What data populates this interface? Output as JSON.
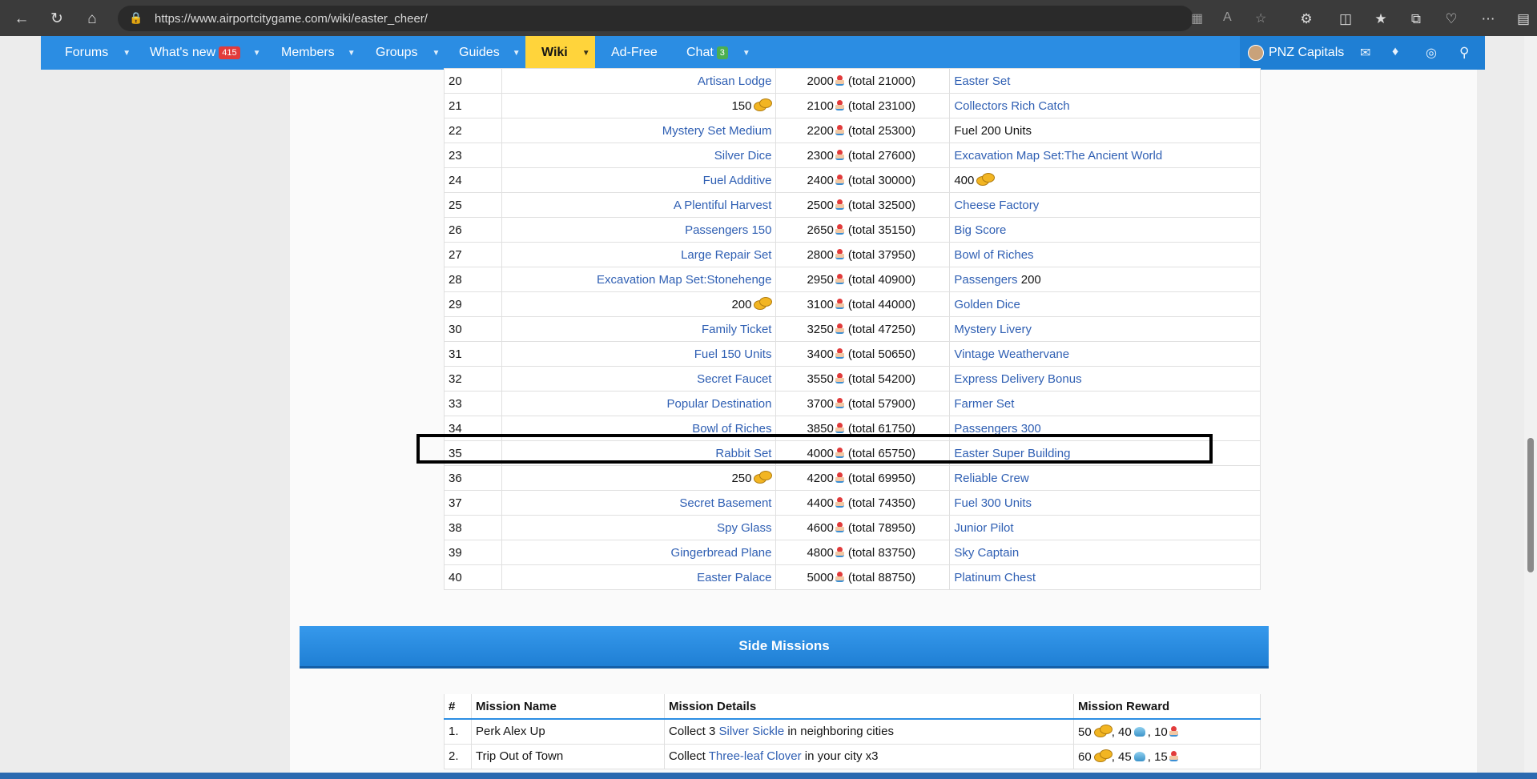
{
  "browser": {
    "url": "https://www.airportcitygame.com/wiki/easter_cheer/"
  },
  "nav": {
    "forums": "Forums",
    "whats_new": "What's new",
    "whats_new_badge": "415",
    "members": "Members",
    "groups": "Groups",
    "guides": "Guides",
    "wiki": "Wiki",
    "ad_free": "Ad-Free",
    "chat": "Chat",
    "chat_badge": "3",
    "username": "PNZ Capitals"
  },
  "colors": {
    "nav_bg": "#2b8de3",
    "wiki_tab": "#ffd43b",
    "link": "#2f5fb3",
    "badge_new": "#e23b3b",
    "badge_chat": "#4caf50"
  },
  "rewards_rows": [
    {
      "num": "20",
      "reward": "Artisan Lodge",
      "reward_link": true,
      "reward_coin": false,
      "points": "2000",
      "total": "(total 21000)",
      "final": "Easter Set",
      "final_link": true,
      "final_coin": false,
      "final_suffix": ""
    },
    {
      "num": "21",
      "reward": "150",
      "reward_link": false,
      "reward_coin": true,
      "points": "2100",
      "total": "(total 23100)",
      "final": "Collectors Rich Catch",
      "final_link": true,
      "final_coin": false,
      "final_suffix": ""
    },
    {
      "num": "22",
      "reward": "Mystery Set Medium",
      "reward_link": true,
      "reward_coin": false,
      "points": "2200",
      "total": "(total 25300)",
      "final": "Fuel 200 Units",
      "final_link": false,
      "final_coin": false,
      "final_suffix": ""
    },
    {
      "num": "23",
      "reward": "Silver Dice",
      "reward_link": true,
      "reward_coin": false,
      "points": "2300",
      "total": "(total 27600)",
      "final": "Excavation Map Set:The Ancient World",
      "final_link": true,
      "final_coin": false,
      "final_suffix": ""
    },
    {
      "num": "24",
      "reward": "Fuel Additive",
      "reward_link": true,
      "reward_coin": false,
      "points": "2400",
      "total": "(total 30000)",
      "final": "400",
      "final_link": false,
      "final_coin": true,
      "final_suffix": ""
    },
    {
      "num": "25",
      "reward": "A Plentiful Harvest",
      "reward_link": true,
      "reward_coin": false,
      "points": "2500",
      "total": "(total 32500)",
      "final": "Cheese Factory",
      "final_link": true,
      "final_coin": false,
      "final_suffix": ""
    },
    {
      "num": "26",
      "reward": "Passengers 150",
      "reward_link": true,
      "reward_coin": false,
      "points": "2650",
      "total": "(total 35150)",
      "final": "Big Score",
      "final_link": true,
      "final_coin": false,
      "final_suffix": ""
    },
    {
      "num": "27",
      "reward": "Large Repair Set",
      "reward_link": true,
      "reward_coin": false,
      "points": "2800",
      "total": "(total 37950)",
      "final": "Bowl of Riches",
      "final_link": true,
      "final_coin": false,
      "final_suffix": ""
    },
    {
      "num": "28",
      "reward": "Excavation Map Set:Stonehenge",
      "reward_link": true,
      "reward_coin": false,
      "points": "2950",
      "total": "(total 40900)",
      "final": "Passengers",
      "final_link": true,
      "final_coin": false,
      "final_suffix": " 200"
    },
    {
      "num": "29",
      "reward": "200",
      "reward_link": false,
      "reward_coin": true,
      "points": "3100",
      "total": "(total 44000)",
      "final": "Golden Dice",
      "final_link": true,
      "final_coin": false,
      "final_suffix": ""
    },
    {
      "num": "30",
      "reward": "Family Ticket",
      "reward_link": true,
      "reward_coin": false,
      "points": "3250",
      "total": "(total 47250)",
      "final": "Mystery Livery",
      "final_link": true,
      "final_coin": false,
      "final_suffix": ""
    },
    {
      "num": "31",
      "reward": "Fuel 150 Units",
      "reward_link": true,
      "reward_coin": false,
      "points": "3400",
      "total": "(total 50650)",
      "final": "Vintage Weathervane",
      "final_link": true,
      "final_coin": false,
      "final_suffix": ""
    },
    {
      "num": "32",
      "reward": "Secret Faucet",
      "reward_link": true,
      "reward_coin": false,
      "points": "3550",
      "total": "(total 54200)",
      "final": "Express Delivery Bonus",
      "final_link": true,
      "final_coin": false,
      "final_suffix": ""
    },
    {
      "num": "33",
      "reward": "Popular Destination",
      "reward_link": true,
      "reward_coin": false,
      "points": "3700",
      "total": "(total 57900)",
      "final": "Farmer Set",
      "final_link": true,
      "final_coin": false,
      "final_suffix": ""
    },
    {
      "num": "34",
      "reward": "Bowl of Riches",
      "reward_link": true,
      "reward_coin": false,
      "points": "3850",
      "total": "(total 61750)",
      "final": "Passengers 300",
      "final_link": true,
      "final_coin": false,
      "final_suffix": ""
    },
    {
      "num": "35",
      "reward": "Rabbit Set",
      "reward_link": true,
      "reward_coin": false,
      "points": "4000",
      "total": "(total 65750)",
      "final": "Easter Super Building",
      "final_link": true,
      "final_coin": false,
      "final_suffix": ""
    },
    {
      "num": "36",
      "reward": "250",
      "reward_link": false,
      "reward_coin": true,
      "points": "4200",
      "total": "(total 69950)",
      "final": "Reliable Crew",
      "final_link": true,
      "final_coin": false,
      "final_suffix": ""
    },
    {
      "num": "37",
      "reward": "Secret Basement",
      "reward_link": true,
      "reward_coin": false,
      "points": "4400",
      "total": "(total 74350)",
      "final": "Fuel 300 Units",
      "final_link": true,
      "final_coin": false,
      "final_suffix": ""
    },
    {
      "num": "38",
      "reward": "Spy Glass",
      "reward_link": true,
      "reward_coin": false,
      "points": "4600",
      "total": "(total 78950)",
      "final": "Junior Pilot",
      "final_link": true,
      "final_coin": false,
      "final_suffix": ""
    },
    {
      "num": "39",
      "reward": "Gingerbread Plane",
      "reward_link": true,
      "reward_coin": false,
      "points": "4800",
      "total": "(total 83750)",
      "final": "Sky Captain",
      "final_link": true,
      "final_coin": false,
      "final_suffix": ""
    },
    {
      "num": "40",
      "reward": "Easter Palace",
      "reward_link": true,
      "reward_coin": false,
      "points": "5000",
      "total": "(total 88750)",
      "final": "Platinum Chest",
      "final_link": true,
      "final_coin": false,
      "final_suffix": ""
    }
  ],
  "side_missions": {
    "title": "Side Missions",
    "headers": {
      "num": "#",
      "name": "Mission Name",
      "details": "Mission Details",
      "reward": "Mission Reward"
    },
    "rows": [
      {
        "num": "1.",
        "name": "Perk Alex Up",
        "pre": "Collect 3 ",
        "link": "Silver Sickle",
        "post": " in neighboring cities",
        "coins": "50",
        "gems": "40",
        "cakes": "10"
      },
      {
        "num": "2.",
        "name": "Trip Out of Town",
        "pre": "Collect ",
        "link": "Three-leaf Clover",
        "post": " in your city x3",
        "coins": "60",
        "gems": "45",
        "cakes": "15"
      }
    ]
  }
}
